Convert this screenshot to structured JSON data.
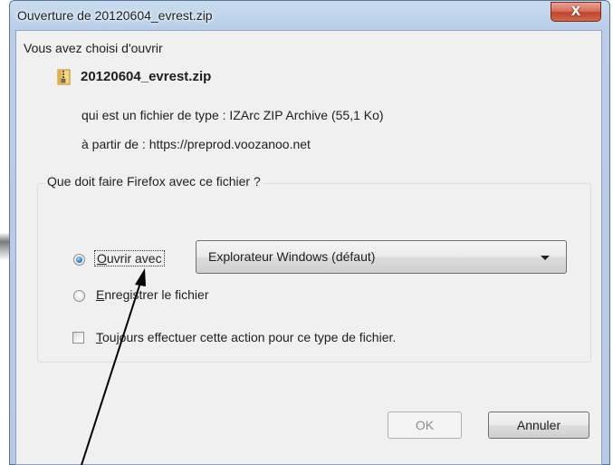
{
  "window": {
    "title": "Ouverture de 20120604_evrest.zip",
    "close_label": "X"
  },
  "dialog": {
    "intro": "Vous avez choisi d'ouvrir",
    "file_name": "20120604_evrest.zip",
    "file_type_line": "qui est un fichier de type : IZArc ZIP Archive (55,1 Ko)",
    "file_source_line": "à partir de : https://preprod.voozanoo.net",
    "group_legend": "Que doit faire Firefox avec ce fichier ?",
    "options": {
      "open_with": {
        "accesskey": "O",
        "rest": "uvrir avec",
        "checked": true
      },
      "save": {
        "accesskey": "E",
        "rest": "nregistrer le fichier",
        "checked": false
      }
    },
    "open_with_select": {
      "selected": "Explorateur Windows (défaut)"
    },
    "always_checkbox": {
      "accesskey": "T",
      "rest": "oujours effectuer cette action pour ce type de fichier.",
      "checked": false
    },
    "buttons": {
      "ok": "OK",
      "cancel": "Annuler"
    }
  },
  "icons": {
    "file_icon": "zip-archive-icon",
    "radio_selected_color": "#2d7fc9"
  }
}
